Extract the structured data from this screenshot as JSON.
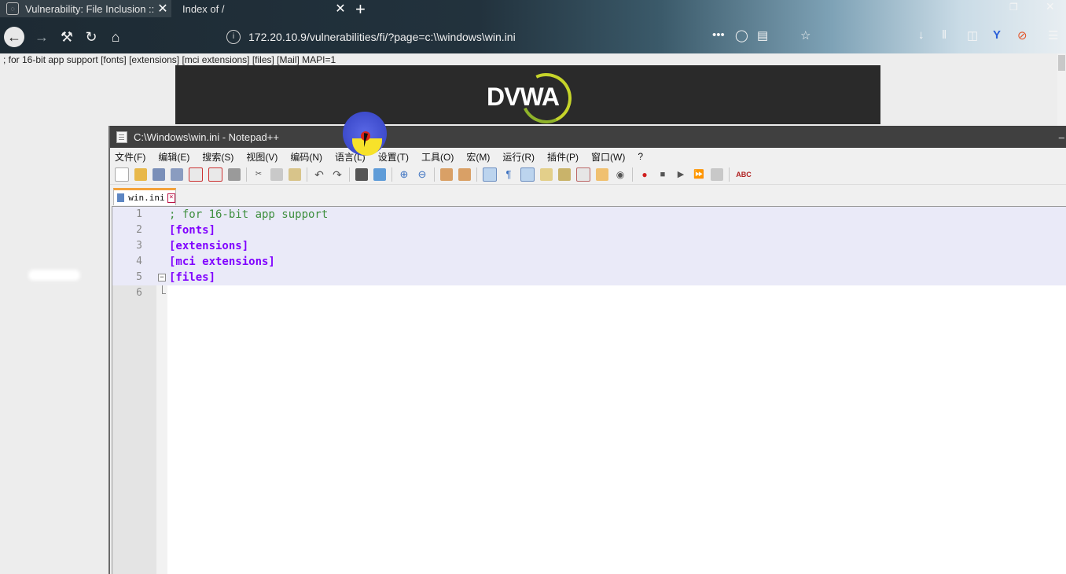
{
  "browser": {
    "tabs": [
      {
        "title": "Vulnerability: File Inclusion ::",
        "active": true
      },
      {
        "title": "Index of /",
        "active": false
      }
    ],
    "url": "172.20.10.9/vulnerabilities/fi/?page=c:\\\\windows\\win.ini",
    "new_tab_glyph": "+",
    "close_glyph": "✕"
  },
  "page": {
    "raw_output": "; for 16-bit app support [fonts] [extensions] [mci extensions] [files] [Mail] MAPI=1",
    "logo_text": "DVWA"
  },
  "notepad": {
    "title": "C:\\Windows\\win.ini - Notepad++",
    "menu": [
      "文件(F)",
      "编辑(E)",
      "搜索(S)",
      "视图(V)",
      "编码(N)",
      "语言(L)",
      "设置(T)",
      "工具(O)",
      "宏(M)",
      "运行(R)",
      "插件(P)",
      "窗口(W)",
      "?"
    ],
    "doc_tab": "win.ini",
    "spellcheck_label": "ABC",
    "lines": [
      {
        "num": "1",
        "text": "; for 16-bit app support",
        "kind": "comment"
      },
      {
        "num": "2",
        "text": "[fonts]",
        "kind": "section"
      },
      {
        "num": "3",
        "text": "[extensions]",
        "kind": "section"
      },
      {
        "num": "4",
        "text": "[mci extensions]",
        "kind": "section"
      },
      {
        "num": "5",
        "text": "[files]",
        "kind": "section"
      },
      {
        "num": "6",
        "text": "",
        "kind": "empty"
      }
    ]
  },
  "colors": {
    "comment": "#3f8f3f",
    "section": "#8000ff",
    "tab_accent": "#f4a23a",
    "highlight": "#eaeaf8"
  }
}
